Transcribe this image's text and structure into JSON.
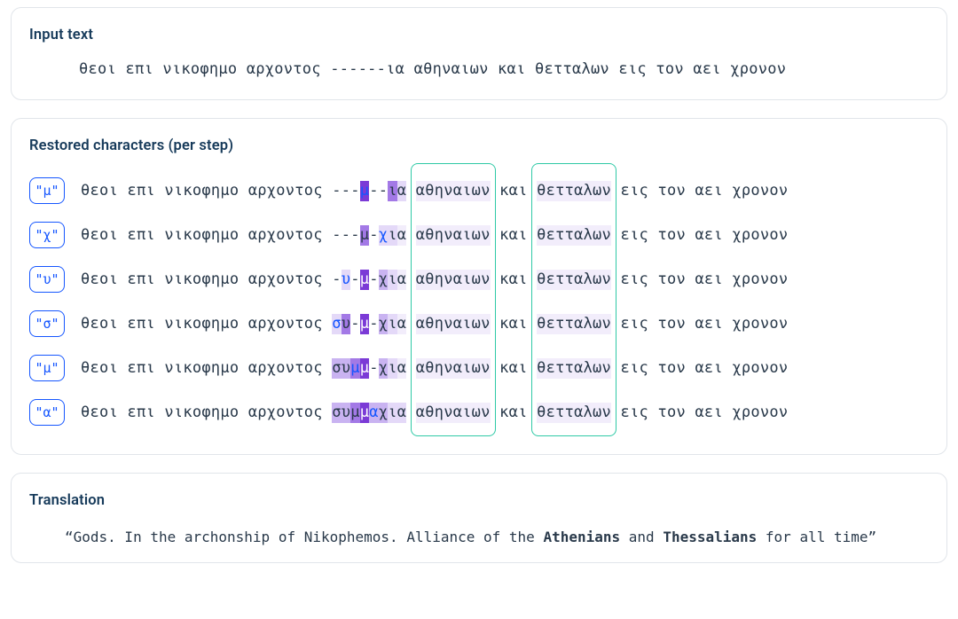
{
  "input": {
    "title": "Input text",
    "text": "θεοι επι νικοφημο αρχοντος ------ια αθηναιων και θετταλων εις τον αει χρονον"
  },
  "restored": {
    "title": "Restored characters (per step)",
    "prefix": "θεοι επι νικοφημο αρχοντος ",
    "word1": "αθηναιων",
    "word_and": "και",
    "word2": "θετταλων",
    "suffix": " εις τον αει χρονον",
    "steps": [
      {
        "label": "\"μ\"",
        "core": [
          {
            "t": "-",
            "cls": ""
          },
          {
            "t": "-",
            "cls": ""
          },
          {
            "t": "-",
            "cls": ""
          },
          {
            "t": "μ",
            "cls": "hl4 blue"
          },
          {
            "t": "-",
            "cls": ""
          },
          {
            "t": "-",
            "cls": ""
          },
          {
            "t": "ι",
            "cls": "hl3"
          },
          {
            "t": "α",
            "cls": "hl1"
          }
        ]
      },
      {
        "label": "\"χ\"",
        "core": [
          {
            "t": "-",
            "cls": ""
          },
          {
            "t": "-",
            "cls": ""
          },
          {
            "t": "-",
            "cls": ""
          },
          {
            "t": "μ",
            "cls": "hl3"
          },
          {
            "t": "-",
            "cls": ""
          },
          {
            "t": "χ",
            "cls": "hl1 blue"
          },
          {
            "t": "ι",
            "cls": "hl1"
          },
          {
            "t": "α",
            "cls": "hl0"
          }
        ]
      },
      {
        "label": "\"υ\"",
        "core": [
          {
            "t": "-",
            "cls": ""
          },
          {
            "t": "υ",
            "cls": "hl1 blue"
          },
          {
            "t": "-",
            "cls": ""
          },
          {
            "t": "μ",
            "cls": "hl4"
          },
          {
            "t": "-",
            "cls": ""
          },
          {
            "t": "χ",
            "cls": "hl2"
          },
          {
            "t": "ι",
            "cls": "hl1"
          },
          {
            "t": "α",
            "cls": "hl0"
          }
        ]
      },
      {
        "label": "\"σ\"",
        "core": [
          {
            "t": "σ",
            "cls": "hl1 blue"
          },
          {
            "t": "υ",
            "cls": "hl3"
          },
          {
            "t": "-",
            "cls": ""
          },
          {
            "t": "μ",
            "cls": "hl4"
          },
          {
            "t": "-",
            "cls": ""
          },
          {
            "t": "χ",
            "cls": "hl2"
          },
          {
            "t": "ι",
            "cls": "hl1"
          },
          {
            "t": "α",
            "cls": "hl0"
          }
        ]
      },
      {
        "label": "\"μ\"",
        "core": [
          {
            "t": "σ",
            "cls": "hl2"
          },
          {
            "t": "υ",
            "cls": "hl2"
          },
          {
            "t": "μ",
            "cls": "hl3 blue"
          },
          {
            "t": "μ",
            "cls": "hl4"
          },
          {
            "t": "-",
            "cls": ""
          },
          {
            "t": "χ",
            "cls": "hl2"
          },
          {
            "t": "ι",
            "cls": "hl1"
          },
          {
            "t": "α",
            "cls": "hl0"
          }
        ]
      },
      {
        "label": "\"α\"",
        "core": [
          {
            "t": "σ",
            "cls": "hl2"
          },
          {
            "t": "υ",
            "cls": "hl2"
          },
          {
            "t": "μ",
            "cls": "hl3"
          },
          {
            "t": "μ",
            "cls": "hl4"
          },
          {
            "t": "α",
            "cls": "hl2 blue"
          },
          {
            "t": "χ",
            "cls": "hl2"
          },
          {
            "t": "ι",
            "cls": "hl1"
          },
          {
            "t": "α",
            "cls": "hl1"
          }
        ]
      }
    ]
  },
  "translation": {
    "title": "Translation",
    "parts": {
      "a": "“Gods. In the archonship of Nikophemos. Alliance of the ",
      "b": "Athenians",
      "c": " and ",
      "d": "Thessalians",
      "e": " for all time”"
    }
  }
}
